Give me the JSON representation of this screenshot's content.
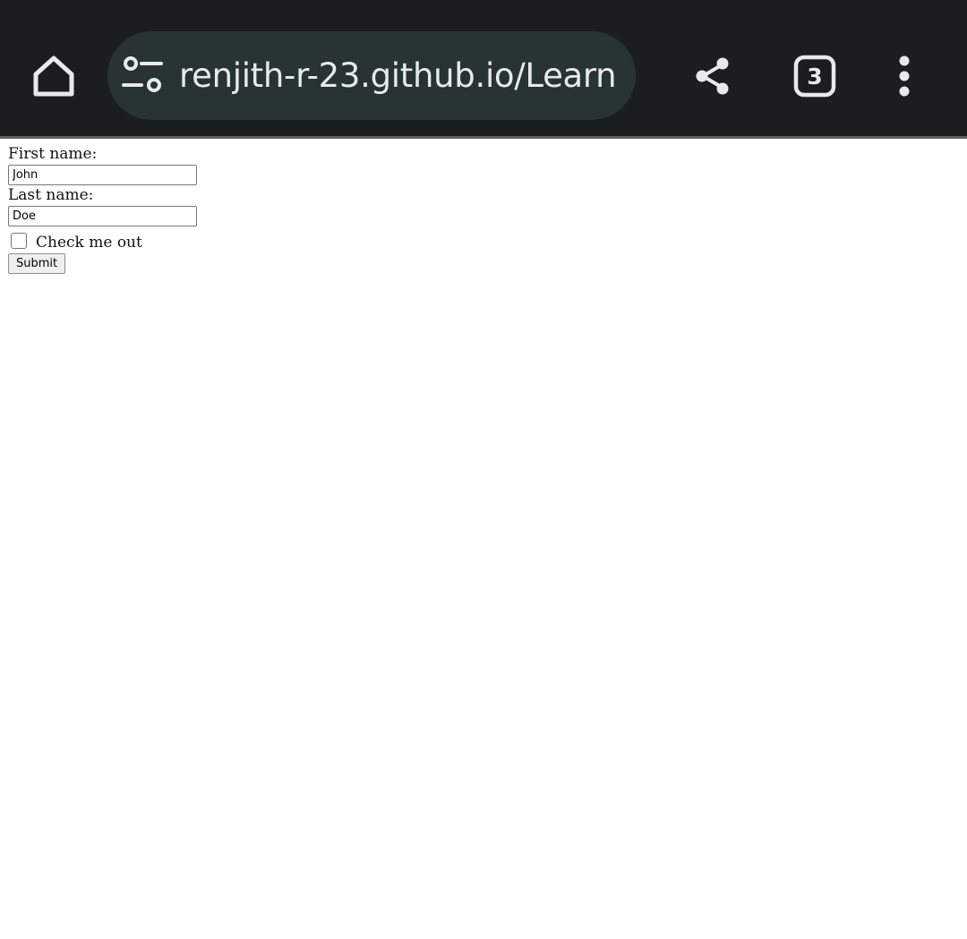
{
  "browser": {
    "url": "renjith-r-23.github.io/Learn",
    "tab_count": "3",
    "icons": {
      "home": "home-icon",
      "site_settings": "tune-icon",
      "share": "share-icon",
      "tabs": "tab-switcher-icon",
      "menu": "more-vert-icon"
    },
    "colors": {
      "toolbar": "#1b1e20",
      "urlbar": "#283335",
      "icon": "#e6eaeb"
    }
  },
  "form": {
    "first_name_label": "First name:",
    "first_name_value": "John",
    "last_name_label": "Last name:",
    "last_name_value": "Doe",
    "checkbox_label": "Check me out",
    "checkbox_checked": false,
    "submit_label": "Submit"
  }
}
